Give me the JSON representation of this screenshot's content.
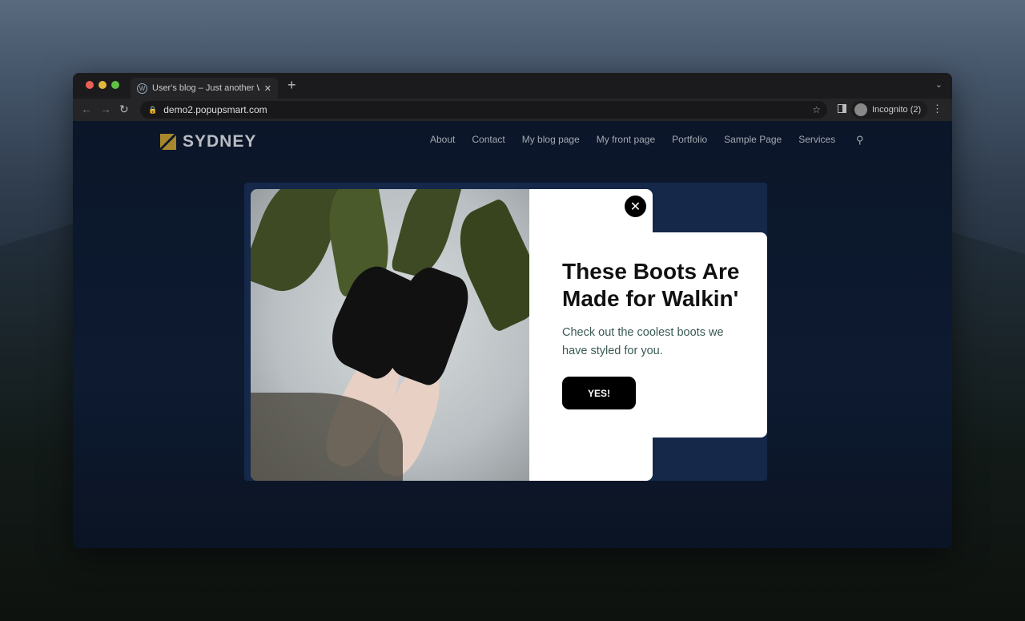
{
  "browser": {
    "tab_title": "User's blog – Just another Wor",
    "url": "demo2.popupsmart.com",
    "profile": "Incognito (2)"
  },
  "site": {
    "logo": "SYDNEY",
    "menu": [
      "About",
      "Contact",
      "My blog page",
      "My front page",
      "Portfolio",
      "Sample Page",
      "Services"
    ]
  },
  "popup": {
    "title": "These Boots Are Made for Walkin'",
    "body": "Check out the coolest boots we have styled for you.",
    "cta": "YES!"
  },
  "colors": {
    "panel": "#15284a",
    "button": "#000000",
    "body_text": "#3a5a55",
    "logo_accent": "#a8882c"
  }
}
